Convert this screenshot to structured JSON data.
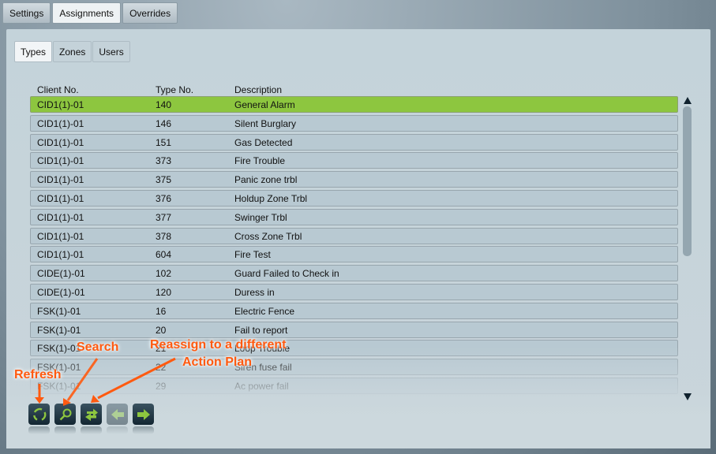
{
  "top_tabs": [
    {
      "label": "Settings"
    },
    {
      "label": "Assignments",
      "active": true
    },
    {
      "label": "Overrides"
    }
  ],
  "sub_tabs": [
    {
      "label": "Types",
      "active": true
    },
    {
      "label": "Zones"
    },
    {
      "label": "Users"
    }
  ],
  "columns": [
    "Client No.",
    "Type No.",
    "Description"
  ],
  "rows": [
    [
      "CID1(1)-01",
      "140",
      "General Alarm"
    ],
    [
      "CID1(1)-01",
      "146",
      "Silent Burglary"
    ],
    [
      "CID1(1)-01",
      "151",
      "Gas Detected"
    ],
    [
      "CID1(1)-01",
      "373",
      "Fire Trouble"
    ],
    [
      "CID1(1)-01",
      "375",
      "Panic zone trbl"
    ],
    [
      "CID1(1)-01",
      "376",
      "Holdup Zone Trbl"
    ],
    [
      "CID1(1)-01",
      "377",
      "Swinger Trbl"
    ],
    [
      "CID1(1)-01",
      "378",
      "Cross Zone Trbl"
    ],
    [
      "CID1(1)-01",
      "604",
      "Fire Test"
    ],
    [
      "CIDE(1)-01",
      "102",
      "Guard Failed to Check in"
    ],
    [
      "CIDE(1)-01",
      "120",
      "Duress in"
    ],
    [
      "FSK(1)-01",
      "16",
      "Electric Fence"
    ],
    [
      "FSK(1)-01",
      "20",
      "Fail to report"
    ],
    [
      "FSK(1)-01",
      "21",
      "Loop Trouble"
    ],
    [
      "FSK(1)-01",
      "22",
      "Siren fuse fail"
    ],
    [
      "FSK(1)-01",
      "29",
      "Ac power fail"
    ]
  ],
  "selected_row": 0,
  "toolbar": [
    {
      "icon": "refresh-icon"
    },
    {
      "icon": "search-icon"
    },
    {
      "icon": "reassign-icon"
    },
    {
      "icon": "arrow-left-icon",
      "disabled": true
    },
    {
      "icon": "arrow-right-icon"
    }
  ],
  "annotations": {
    "refresh": "Refresh",
    "search": "Search",
    "reassign_line1": "Reassign to a different",
    "reassign_line2": "Action Plan"
  },
  "colors": {
    "selected_row": "#8dc63f",
    "icon_green": "#8dc63f",
    "annotation": "#ff5a10"
  }
}
